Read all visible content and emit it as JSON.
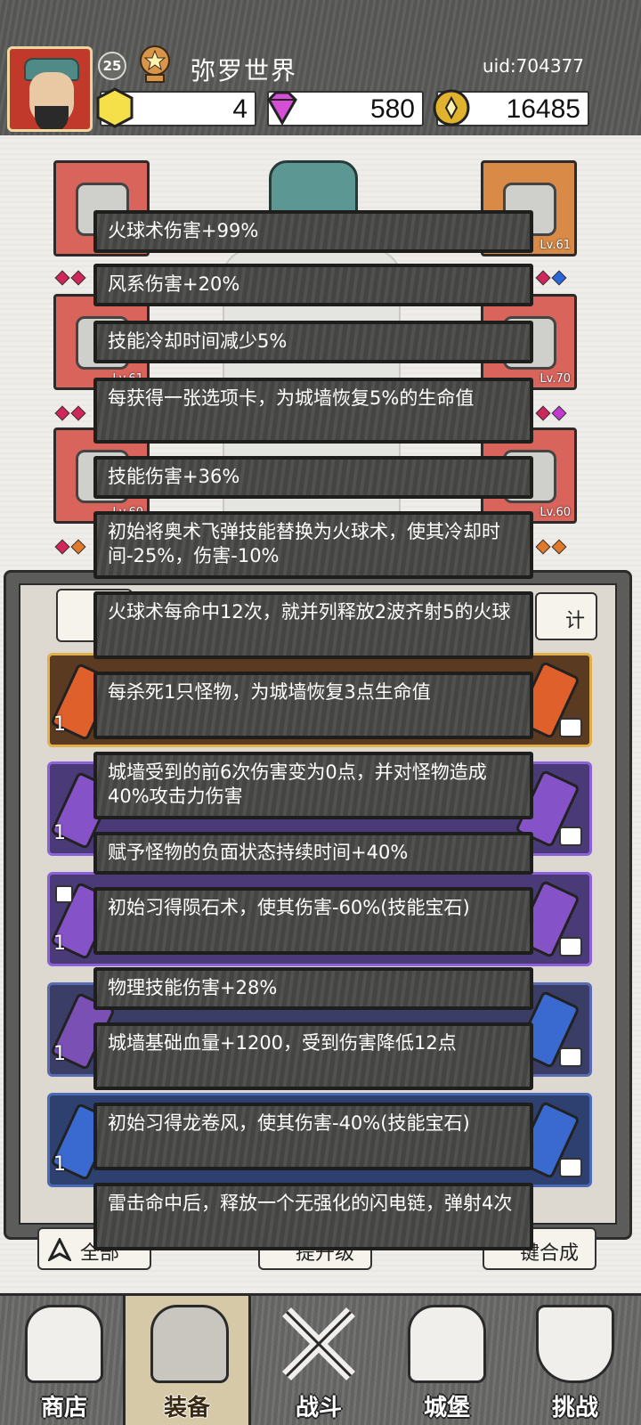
{
  "header": {
    "level": "25",
    "player_name": "弥罗世界",
    "uid": "uid:704377",
    "resources": [
      {
        "name": "gold-gem",
        "value": "4",
        "color": "#f5e04a"
      },
      {
        "name": "diamond",
        "value": "580",
        "color": "#d44fd6"
      },
      {
        "name": "coin",
        "value": "16485",
        "color": "#e0b22e"
      }
    ]
  },
  "equipment": {
    "slot_levels": [
      "Lv.61",
      "Lv.70",
      "Lv.60",
      "Lv.60",
      "Lv.61"
    ]
  },
  "inventory": {
    "stat_button": "计",
    "counts": [
      "1",
      "1",
      "1",
      "1",
      "1",
      "1"
    ],
    "bottom_buttons": [
      "全部",
      "提升级",
      "键合成"
    ]
  },
  "tooltip": {
    "effects": [
      "火球术伤害+99%",
      "风系伤害+20%",
      "技能冷却时间减少5%",
      "每获得一张选项卡，为城墙恢复5%的生命值",
      "技能伤害+36%",
      "初始将奥术飞弹技能替换为火球术，使其冷却时间-25%，伤害-10%",
      "火球术每命中12次，就并列释放2波齐射5的火球",
      "每杀死1只怪物，为城墙恢复3点生命值",
      "城墙受到的前6次伤害变为0点，并对怪物造成40%攻击力伤害",
      "赋予怪物的负面状态持续时间+40%",
      "初始习得陨石术，使其伤害-60%(技能宝石)",
      "物理技能伤害+28%",
      "城墙基础血量+1200，受到伤害降低12点",
      "初始习得龙卷风，使其伤害-40%(技能宝石)",
      "雷击命中后，释放一个无强化的闪电链，弹射4次"
    ]
  },
  "nav": {
    "items": [
      {
        "label": "商店",
        "icon": "shop-icon"
      },
      {
        "label": "装备",
        "icon": "backpack-icon"
      },
      {
        "label": "战斗",
        "icon": "crossed-swords-icon"
      },
      {
        "label": "城堡",
        "icon": "castle-icon"
      },
      {
        "label": "挑战",
        "icon": "shield-challenge-icon"
      }
    ],
    "active_index": 1
  }
}
